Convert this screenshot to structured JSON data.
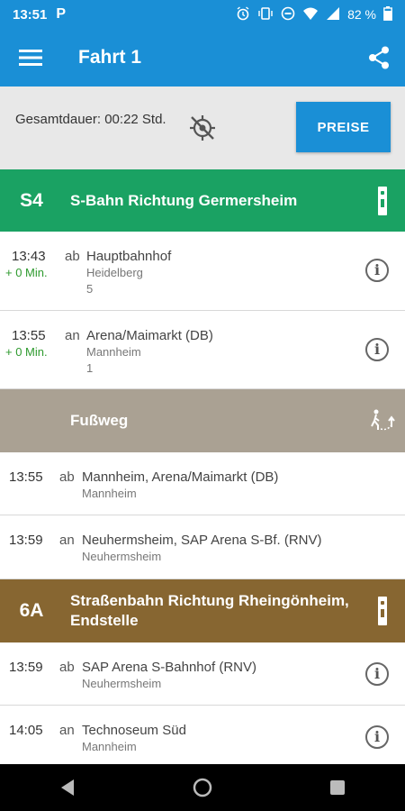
{
  "status_bar": {
    "time": "13:51",
    "app_indicator": "P",
    "battery": "82 %",
    "icons": [
      "alarm-icon",
      "vibrate-icon",
      "dnd-icon",
      "wifi-icon",
      "signal-icon",
      "battery-icon"
    ]
  },
  "app_bar": {
    "title": "Fahrt 1",
    "icons": [
      "menu-icon",
      "share-icon"
    ]
  },
  "summary": {
    "duration": "Gesamtdauer: 00:22 Std.",
    "preise_label": "PREISE"
  },
  "legs": [
    {
      "line": "S4",
      "direction": "S-Bahn Richtung Germersheim",
      "color": "#1aa263",
      "stops": [
        {
          "time": "13:43",
          "delay": "+ 0 Min.",
          "type": "ab",
          "name": "Hauptbahnhof",
          "city": "Heidelberg",
          "platform": "5"
        },
        {
          "time": "13:55",
          "delay": "+ 0 Min.",
          "type": "an",
          "name": "Arena/Maimarkt (DB)",
          "city": "Mannheim",
          "platform": "1"
        }
      ]
    },
    {
      "line": "",
      "direction": "Fußweg",
      "color": "#aaa193",
      "stops": [
        {
          "time": "13:55",
          "type": "ab",
          "name": "Mannheim, Arena/Maimarkt (DB)",
          "city": "Mannheim"
        },
        {
          "time": "13:59",
          "type": "an",
          "name": "Neuhermsheim, SAP Arena S-Bf. (RNV)",
          "city": "Neuhermsheim"
        }
      ]
    },
    {
      "line": "6A",
      "direction": "Straßenbahn Richtung Rheingönheim, Endstelle",
      "color": "#876631",
      "stops": [
        {
          "time": "13:59",
          "type": "ab",
          "name": "SAP Arena S-Bahnhof (RNV)",
          "city": "Neuhermsheim"
        },
        {
          "time": "14:05",
          "type": "an",
          "name": "Technoseum Süd",
          "city": "Mannheim"
        }
      ]
    }
  ],
  "colors": {
    "primary": "#1a8fd6",
    "summary_bg": "#e8e8e8",
    "delay_green": "#2e9a2e"
  }
}
